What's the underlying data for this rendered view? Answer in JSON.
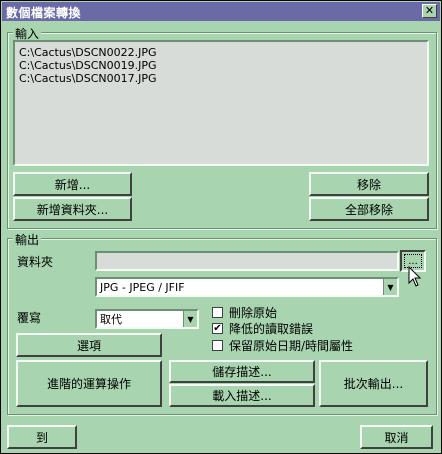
{
  "window": {
    "title": "數個檔案轉換",
    "close_glyph": "✕"
  },
  "input": {
    "legend": "輸入",
    "files": [
      "C:\\Cactus\\DSCN0022.JPG",
      "C:\\Cactus\\DSCN0019.JPG",
      "C:\\Cactus\\DSCN0017.JPG"
    ],
    "add_label": "新增...",
    "add_folder_label": "新增資料夾...",
    "remove_label": "移除",
    "remove_all_label": "全部移除"
  },
  "output": {
    "legend": "輸出",
    "folder_label": "資料夾",
    "folder_value": "",
    "browse_label": "...",
    "format_value": "JPG - JPEG / JFIF",
    "overwrite_label": "覆寫",
    "overwrite_value": "取代",
    "checkboxes": [
      {
        "label": "刪除原始",
        "checked": false
      },
      {
        "label": "降低的讀取錯誤",
        "checked": true
      },
      {
        "label": "保留原始日期/時間屬性",
        "checked": false
      }
    ],
    "options_label": "選項",
    "advanced_label": "進階的運算操作",
    "save_desc_label": "儲存描述...",
    "load_desc_label": "載入描述...",
    "batch_label": "批次輸出..."
  },
  "footer": {
    "goto_label": "到",
    "cancel_label": "取消"
  },
  "colors": {
    "face": "#a8d4b0",
    "titlebar": "#6a6aa6",
    "list_bg": "#d8dcd8"
  },
  "icons": {
    "dropdown": "triangle-down",
    "checkmark": "check",
    "cursor": "arrow-pointer"
  }
}
